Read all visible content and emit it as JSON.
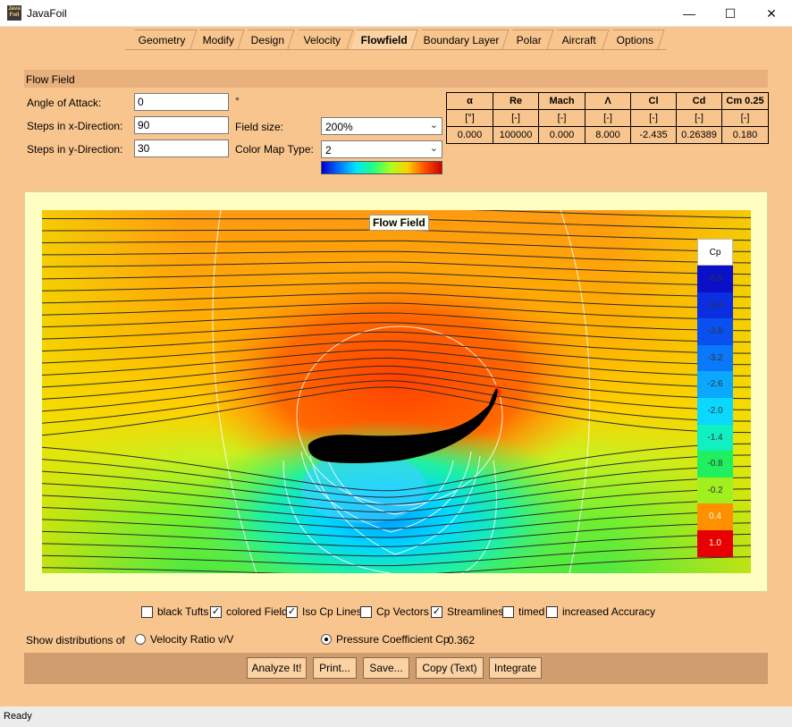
{
  "window": {
    "title": "JavaFoil",
    "icon_text_top": "Java",
    "icon_text_bottom": "Foil"
  },
  "window_controls": {
    "minimize": "—",
    "maximize": "☐",
    "close": "✕"
  },
  "tabs": [
    {
      "label": "Geometry"
    },
    {
      "label": "Modify"
    },
    {
      "label": "Design"
    },
    {
      "label": "Velocity"
    },
    {
      "label": "Flowfield"
    },
    {
      "label": "Boundary Layer"
    },
    {
      "label": "Polar"
    },
    {
      "label": "Aircraft"
    },
    {
      "label": "Options"
    }
  ],
  "active_tab": "Flowfield",
  "section": {
    "title": "Flow Field"
  },
  "form": {
    "angle_label": "Angle of Attack:",
    "angle_value": "0",
    "angle_unit": "°",
    "stepsx_label": "Steps in x-Direction:",
    "stepsx_value": "90",
    "stepsy_label": "Steps in y-Direction:",
    "stepsy_value": "30",
    "fieldsize_label": "Field size:",
    "fieldsize_value": "200%",
    "colormap_label": "Color Map Type:",
    "colormap_value": "2"
  },
  "results_table": {
    "headers": [
      "α",
      "Re",
      "Mach",
      "Λ",
      "Cl",
      "Cd",
      "Cm 0.25"
    ],
    "units": [
      "[°]",
      "[-]",
      "[-]",
      "[-]",
      "[-]",
      "[-]",
      "[-]"
    ],
    "values": [
      "0.000",
      "100000",
      "0.000",
      "8.000",
      "-2.435",
      "0.26389",
      "0.180"
    ]
  },
  "flowfield": {
    "title": "Flow Field",
    "legend_title": "Cp",
    "legend": [
      {
        "label": "-5.0",
        "color": "#0a10c8"
      },
      {
        "label": "-4.4",
        "color": "#0a2ee0"
      },
      {
        "label": "-3.8",
        "color": "#0a50f0"
      },
      {
        "label": "-3.2",
        "color": "#0a78f8"
      },
      {
        "label": "-2.6",
        "color": "#0aa8ff"
      },
      {
        "label": "-2.0",
        "color": "#0ad8ff"
      },
      {
        "label": "-1.4",
        "color": "#10f0c0"
      },
      {
        "label": "-0.8",
        "color": "#20f060"
      },
      {
        "label": "-0.2",
        "color": "#a0f020"
      },
      {
        "label": "0.4",
        "color": "#ff9000"
      },
      {
        "label": "1.0",
        "color": "#e80000"
      }
    ]
  },
  "options": [
    {
      "label": "black Tufts",
      "checked": false
    },
    {
      "label": "colored Field",
      "checked": true
    },
    {
      "label": "Iso Cp Lines",
      "checked": true
    },
    {
      "label": "Cp Vectors",
      "checked": false
    },
    {
      "label": "Streamlines",
      "checked": true
    },
    {
      "label": "timed",
      "checked": false
    },
    {
      "label": "increased Accuracy",
      "checked": false
    }
  ],
  "distribution": {
    "label": "Show distributions of",
    "velocity_label": "Velocity Ratio v/V",
    "pressure_label": "Pressure Coefficient Cp",
    "selected": "pressure",
    "value": "0.362"
  },
  "buttons": [
    "Analyze It!",
    "Print...",
    "Save...",
    "Copy (Text)",
    "Integrate"
  ],
  "status": "Ready",
  "colors": {
    "background": "#f9c58e",
    "header": "#e8b07c",
    "button_bar": "#cf9d6e",
    "field_frame": "#fefec2"
  }
}
